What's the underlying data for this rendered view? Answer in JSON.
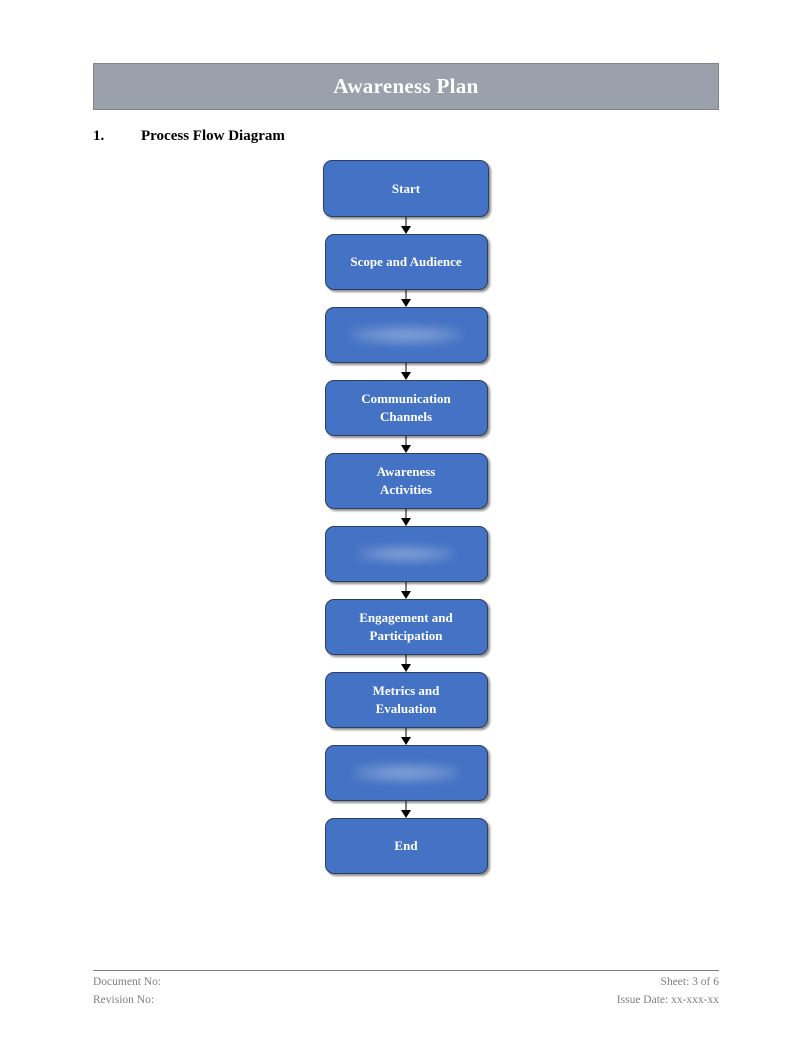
{
  "document": {
    "title": "Awareness Plan",
    "banner_color": "#9BA1AB",
    "box_color": "#4472C4"
  },
  "section": {
    "number": "1.",
    "label": "Process Flow Diagram"
  },
  "flowchart": {
    "nodes": [
      {
        "label": "Start",
        "redacted": false
      },
      {
        "label": "Scope and Audience",
        "redacted": false
      },
      {
        "label": "",
        "redacted": true
      },
      {
        "label": "Communication\nChannels",
        "redacted": false
      },
      {
        "label": "Awareness\nActivities",
        "redacted": false
      },
      {
        "label": "",
        "redacted": true
      },
      {
        "label": "Engagement and\nParticipation",
        "redacted": false
      },
      {
        "label": "Metrics and\nEvaluation",
        "redacted": false
      },
      {
        "label": "",
        "redacted": true
      },
      {
        "label": "End",
        "redacted": false
      }
    ]
  },
  "footer": {
    "document_no_label": "Document No:",
    "revision_no_label": "Revision No:",
    "sheet": "Sheet: 3 of 6",
    "issue_date": "Issue Date: xx-xxx-xx"
  }
}
